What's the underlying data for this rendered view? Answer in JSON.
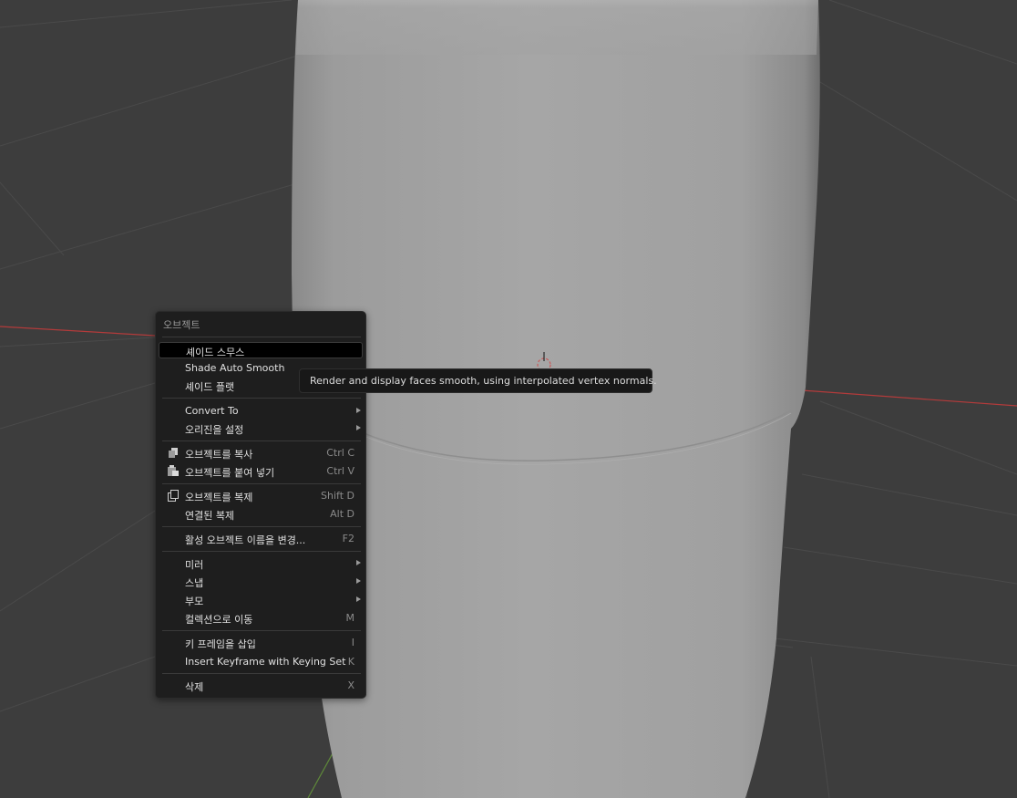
{
  "menu": {
    "title": "오브젝트",
    "items": [
      {
        "label": "셰이드 스무스",
        "shortcut": "",
        "submenu": false,
        "highlighted": true
      },
      {
        "label": "Shade Auto Smooth",
        "shortcut": "",
        "submenu": false
      },
      {
        "label": "셰이드 플랫",
        "shortcut": "",
        "submenu": false
      },
      {
        "label": "Convert To",
        "shortcut": "",
        "submenu": true
      },
      {
        "label": "오리진을 설정",
        "shortcut": "",
        "submenu": true
      },
      {
        "label": "오브젝트를 복사",
        "shortcut": "Ctrl C",
        "submenu": false,
        "icon": "copy-icon"
      },
      {
        "label": "오브젝트를 붙여 넣기",
        "shortcut": "Ctrl V",
        "submenu": false,
        "icon": "paste-icon"
      },
      {
        "label": "오브젝트를 복제",
        "shortcut": "Shift D",
        "submenu": false,
        "icon": "duplicate-icon"
      },
      {
        "label": "연결된 복제",
        "shortcut": "Alt D",
        "submenu": false
      },
      {
        "label": "활성 오브젝트 이름을 변경...",
        "shortcut": "F2",
        "submenu": false
      },
      {
        "label": "미러",
        "shortcut": "",
        "submenu": true
      },
      {
        "label": "스냅",
        "shortcut": "",
        "submenu": true
      },
      {
        "label": "부모",
        "shortcut": "",
        "submenu": true
      },
      {
        "label": "컬렉션으로 이동",
        "shortcut": "M",
        "submenu": false
      },
      {
        "label": "키 프레임을 삽입",
        "shortcut": "I",
        "submenu": false
      },
      {
        "label": "Insert Keyframe with Keying Set",
        "shortcut": "K",
        "submenu": false
      },
      {
        "label": "삭제",
        "shortcut": "X",
        "submenu": false
      }
    ]
  },
  "tooltip": {
    "text": "Render and display faces smooth, using interpolated vertex normals."
  },
  "colors": {
    "viewport_bg": "#3d3d3d",
    "menu_bg": "#1e1e1e",
    "highlight_bg": "#000000",
    "axis_x": "#b33b3b",
    "axis_y": "#5f8a3a"
  }
}
